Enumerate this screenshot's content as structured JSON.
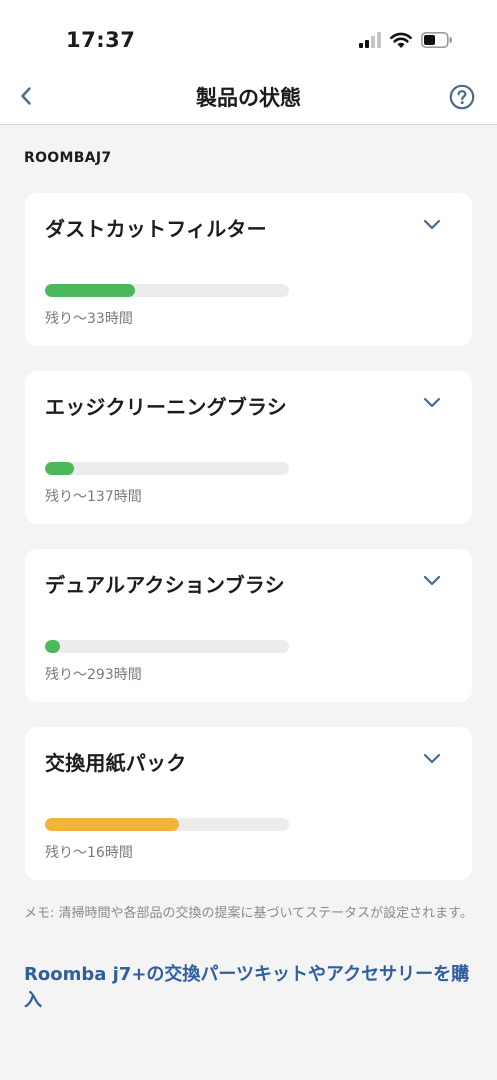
{
  "status_bar": {
    "time": "17:37"
  },
  "nav": {
    "title": "製品の状態"
  },
  "section_label": "ROOMBAJ7",
  "parts": [
    {
      "name": "ダストカットフィルター",
      "remaining": "残り〜33時間",
      "level": 0.37,
      "color": "#4cb85c"
    },
    {
      "name": "エッジクリーニングブラシ",
      "remaining": "残り〜137時間",
      "level": 0.12,
      "color": "#4cb85c"
    },
    {
      "name": "デュアルアクションブラシ",
      "remaining": "残り〜293時間",
      "level": 0.06,
      "color": "#4cb85c"
    },
    {
      "name": "交換用紙パック",
      "remaining": "残り〜16時間",
      "level": 0.55,
      "color": "#f2b33b"
    }
  ],
  "memo": "メモ: 清掃時間や各部品の交換の提案に基づいてステータスが設定されます。",
  "link": "Roomba j7+の交換パーツキットやアクセサリーを購入",
  "icons": {
    "back": "chevron-left-icon",
    "help": "question-circle-icon",
    "expand": "chevron-down-icon"
  },
  "colors": {
    "link": "#2f5f9e",
    "nav_icon": "#4a6a8a",
    "healthy": "#4cb85c",
    "warning": "#f2b33b"
  }
}
